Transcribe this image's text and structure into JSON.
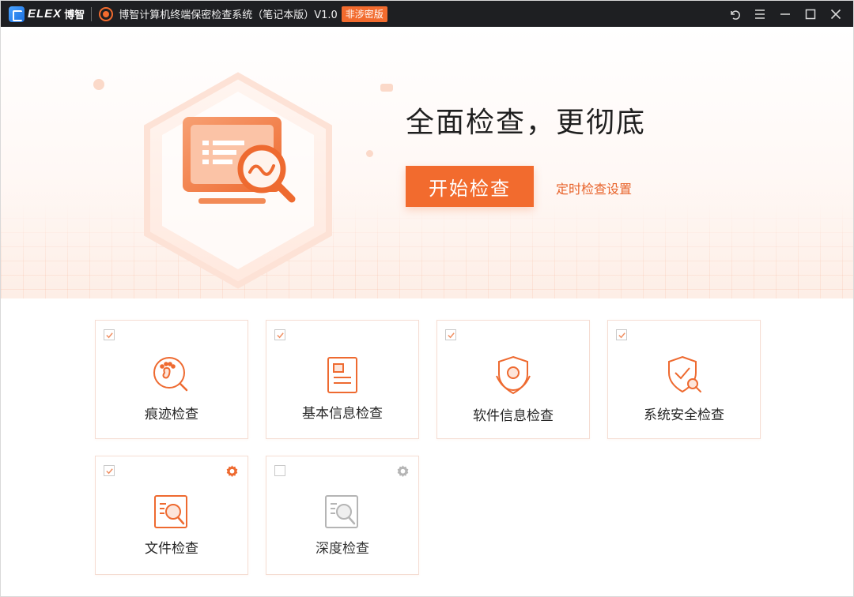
{
  "titlebar": {
    "brand_text": "ELEX",
    "brand_cn": "博智",
    "app_title": "博智计算机终端保密检查系统（笔记本版）V1.0",
    "badge": "非涉密版"
  },
  "hero": {
    "headline": "全面检查，更彻底",
    "start_button": "开始检查",
    "schedule_link": "定时检查设置"
  },
  "cards": [
    {
      "label": "痕迹检查",
      "checked": true,
      "icon": "footprint-search-icon"
    },
    {
      "label": "基本信息检查",
      "checked": true,
      "icon": "info-document-icon"
    },
    {
      "label": "软件信息检查",
      "checked": true,
      "icon": "software-shield-icon"
    },
    {
      "label": "系统安全检查",
      "checked": true,
      "icon": "security-shield-check-icon"
    },
    {
      "label": "文件检查",
      "checked": true,
      "icon": "file-search-icon",
      "has_settings": true
    },
    {
      "label": "深度检查",
      "checked": false,
      "icon": "deep-search-icon",
      "has_settings": true
    }
  ],
  "colors": {
    "accent": "#f26b2e",
    "titlebar_bg": "#1e1f22",
    "card_border": "#f5ddd3",
    "disabled_gray": "#b5b5b5"
  }
}
